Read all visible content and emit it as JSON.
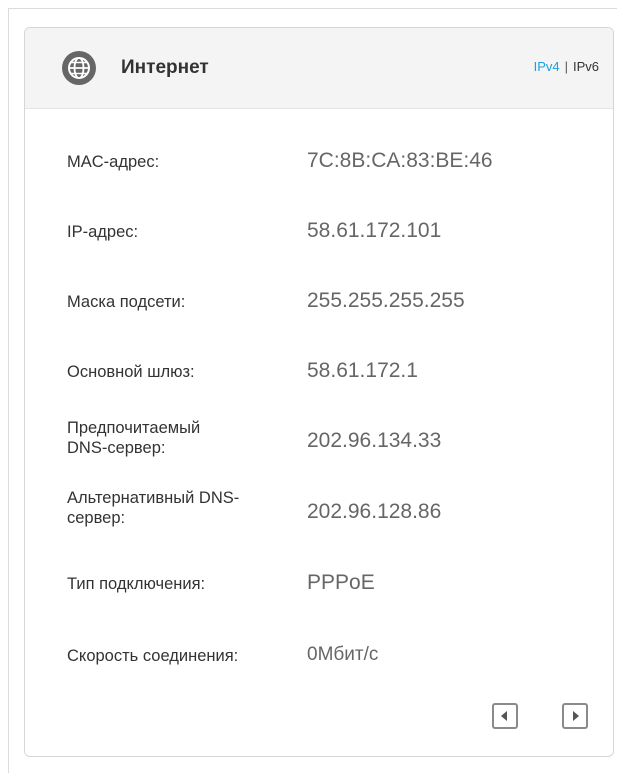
{
  "header": {
    "title": "Интернет",
    "ipv4_label": "IPv4",
    "separator": "|",
    "ipv6_label": "IPv6",
    "icon": "globe-icon"
  },
  "rows": [
    {
      "label": "MAC-адрес:",
      "value": "7C:8B:CA:83:BE:46"
    },
    {
      "label": "IP-адрес:",
      "value": "58.61.172.101"
    },
    {
      "label": "Маска подсети:",
      "value": "255.255.255.255"
    },
    {
      "label": "Основной шлюз:",
      "value": "58.61.172.1"
    },
    {
      "label_line1": "Предпочитаемый",
      "label_line2": "DNS-сервер:",
      "value": "202.96.134.33"
    },
    {
      "label_line1": "Альтернативный DNS-",
      "label_line2": "сервер:",
      "value": "202.96.128.86"
    },
    {
      "label": "Тип подключения:",
      "value": "PPPoE"
    },
    {
      "label": "Скорость соединения:",
      "value": "0Мбит/с"
    }
  ],
  "pager": {
    "prev_icon": "chevron-left-icon",
    "next_icon": "chevron-right-icon"
  },
  "colors": {
    "accent": "#1d9fe0",
    "label_text": "#333333",
    "value_text": "#666666",
    "header_bg": "#f4f4f4"
  }
}
